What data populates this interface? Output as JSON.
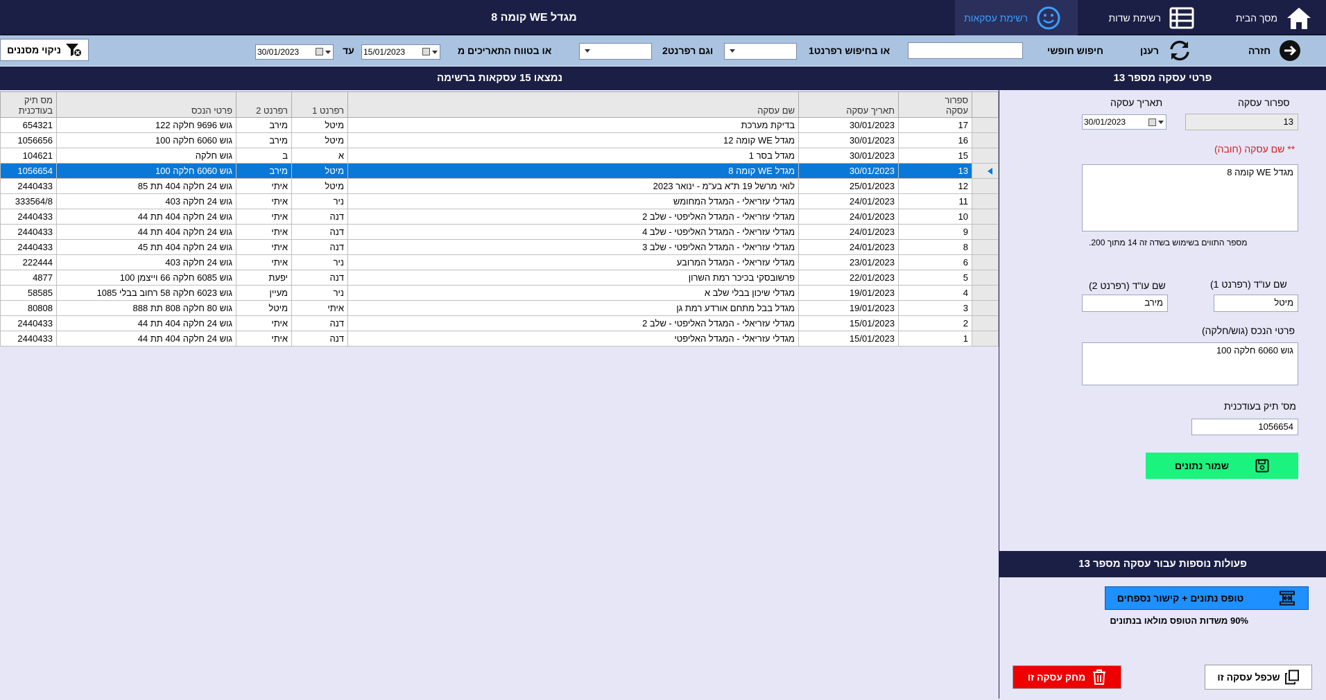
{
  "window": {
    "title": "מגדל WE קומה 8"
  },
  "nav": {
    "home": "מסך הבית",
    "fields_list": "רשימת שדות",
    "deals_list": "רשימת עסקאות"
  },
  "filters": {
    "back": "חזרה",
    "refresh": "רענן",
    "free_search": "חיפוש חופשי",
    "free_search_value": "",
    "ref1_search": "או בחיפוש רפרנט1",
    "ref2_label": "וגם רפרנט2",
    "date_range": "או בטווח התאריכים מ",
    "date_from": "15/01/2023",
    "until": "עד",
    "date_to": "30/01/2023",
    "clear": "ניקוי מסננים"
  },
  "list": {
    "title": "נמצאו 15 עסקאות ברשימה",
    "headers": {
      "num_l1": "ספרור",
      "num_l2": "עסקה",
      "date": "תאריך עסקה",
      "name": "שם עסקה",
      "ref1": "רפרנט 1",
      "ref2": "רפרנט 2",
      "asset": "פרטי הנכס",
      "file_l1": "מס תיק",
      "file_l2": "בעודכנית"
    },
    "rows": [
      {
        "num": "17",
        "date": "30/01/2023",
        "name": "בדיקת מערכת",
        "ref1": "מיטל",
        "ref2": "מירב",
        "asset": "גוש 9696 חלקה 122",
        "file": "654321"
      },
      {
        "num": "16",
        "date": "30/01/2023",
        "name": "מגדל WE קומה 12",
        "ref1": "מיטל",
        "ref2": "מירב",
        "asset": "גוש 6060 חלקה 100",
        "file": "1056656"
      },
      {
        "num": "15",
        "date": "30/01/2023",
        "name": "מגדל בסר 1",
        "ref1": "א",
        "ref2": "ב",
        "asset": "גוש חלקה",
        "file": "104621"
      },
      {
        "num": "13",
        "date": "30/01/2023",
        "name": "מגדל WE קומה 8",
        "ref1": "מיטל",
        "ref2": "מירב",
        "asset": "גוש 6060 חלקה 100",
        "file": "1056654",
        "selected": true
      },
      {
        "num": "12",
        "date": "25/01/2023",
        "name": "לואי מרשל 19 ת\"א בע\"מ - ינואר 2023",
        "ref1": "מיטל",
        "ref2": "איתי",
        "asset": "גוש 24 חלקה 404 תת 85",
        "file": "2440433"
      },
      {
        "num": "11",
        "date": "24/01/2023",
        "name": "מגדלי עזריאלי - המגדל המחומש",
        "ref1": "ניר",
        "ref2": "איתי",
        "asset": "גוש 24 חלקה 403",
        "file": "333564/8"
      },
      {
        "num": "10",
        "date": "24/01/2023",
        "name": "מגדלי עזריאלי - המגדל האליפטי - שלב 2",
        "ref1": "דנה",
        "ref2": "איתי",
        "asset": "גוש 24 חלקה 404 תת 44",
        "file": "2440433"
      },
      {
        "num": "9",
        "date": "24/01/2023",
        "name": "מגדלי עזריאלי - המגדל האליפטי - שלב 4",
        "ref1": "דנה",
        "ref2": "איתי",
        "asset": "גוש 24 חלקה 404 תת 44",
        "file": "2440433"
      },
      {
        "num": "8",
        "date": "24/01/2023",
        "name": "מגדלי עזריאלי - המגדל האליפטי - שלב 3",
        "ref1": "דנה",
        "ref2": "איתי",
        "asset": "גוש 24 חלקה 404 תת 45",
        "file": "2440433"
      },
      {
        "num": "6",
        "date": "23/01/2023",
        "name": "מגדלי עזריאלי - המגדל המרובע",
        "ref1": "ניר",
        "ref2": "איתי",
        "asset": "גוש 24 חלקה 403",
        "file": "222444"
      },
      {
        "num": "5",
        "date": "22/01/2023",
        "name": "פרשובסקי בכיכר רמת השרון",
        "ref1": "דנה",
        "ref2": "יפעת",
        "asset": "גוש 6085 חלקה 66 וייצמן 100",
        "file": "4877"
      },
      {
        "num": "4",
        "date": "19/01/2023",
        "name": "מגדלי שיכון בבלי שלב א",
        "ref1": "ניר",
        "ref2": "מעיין",
        "asset": "גוש 6023 חלקה 58 רחוב בבלי 1085",
        "file": "58585"
      },
      {
        "num": "3",
        "date": "19/01/2023",
        "name": "מגדל בבל מתחם אורדע רמת גן",
        "ref1": "איתי",
        "ref2": "מיטל",
        "asset": "גוש 80 חלקה 808 תת 888",
        "file": "80808"
      },
      {
        "num": "2",
        "date": "15/01/2023",
        "name": "מגדלי עזריאלי - המגדל האליפטי - שלב 2",
        "ref1": "דנה",
        "ref2": "איתי",
        "asset": "גוש 24 חלקה 404 תת 44",
        "file": "2440433"
      },
      {
        "num": "1",
        "date": "15/01/2023",
        "name": "מגדלי עזריאלי - המגדל האליפטי",
        "ref1": "דנה",
        "ref2": "איתי",
        "asset": "גוש 24 חלקה 404 תת 44",
        "file": "2440433"
      }
    ]
  },
  "details": {
    "title": "פרטי עסקה מספר 13",
    "num_label": "ספרור עסקה",
    "num_value": "13",
    "date_label": "תאריך עסקה",
    "date_value": "30/01/2023",
    "name_label": "** שם עסקה (חובה)",
    "name_value": "מגדל WE קומה 8",
    "char_count": "מספר התווים בשימוש בשדה זה 14 מתוך 200.",
    "ref1_label": "שם עו\"ד (רפרנט 1)",
    "ref1_value": "מיטל",
    "ref2_label": "שם עו\"ד (רפרנט 2)",
    "ref2_value": "מירב",
    "asset_label": "פרטי הנכס (גוש/חלקה)",
    "asset_value": "גוש 6060 חלקה 100",
    "file_label": "מס' תיק בעודכנית",
    "file_value": "1056654",
    "save": "שמור נתונים"
  },
  "actions": {
    "title": "פעולות נוספות עבור עסקה מספר 13",
    "merge": "טופס נתונים + קישור נספחים",
    "percent": "90% משדות הטופס מולאו בנתונים",
    "delete": "מחק עסקה זו",
    "duplicate": "שכפל עסקה זו"
  },
  "colors": {
    "navy": "#1b1f45",
    "filter_bar": "#aac3e0",
    "background": "#e6e6f7",
    "selected_row": "#0a78d7",
    "save": "#1af47f",
    "merge": "#1e90ff",
    "delete": "#ee0000"
  }
}
